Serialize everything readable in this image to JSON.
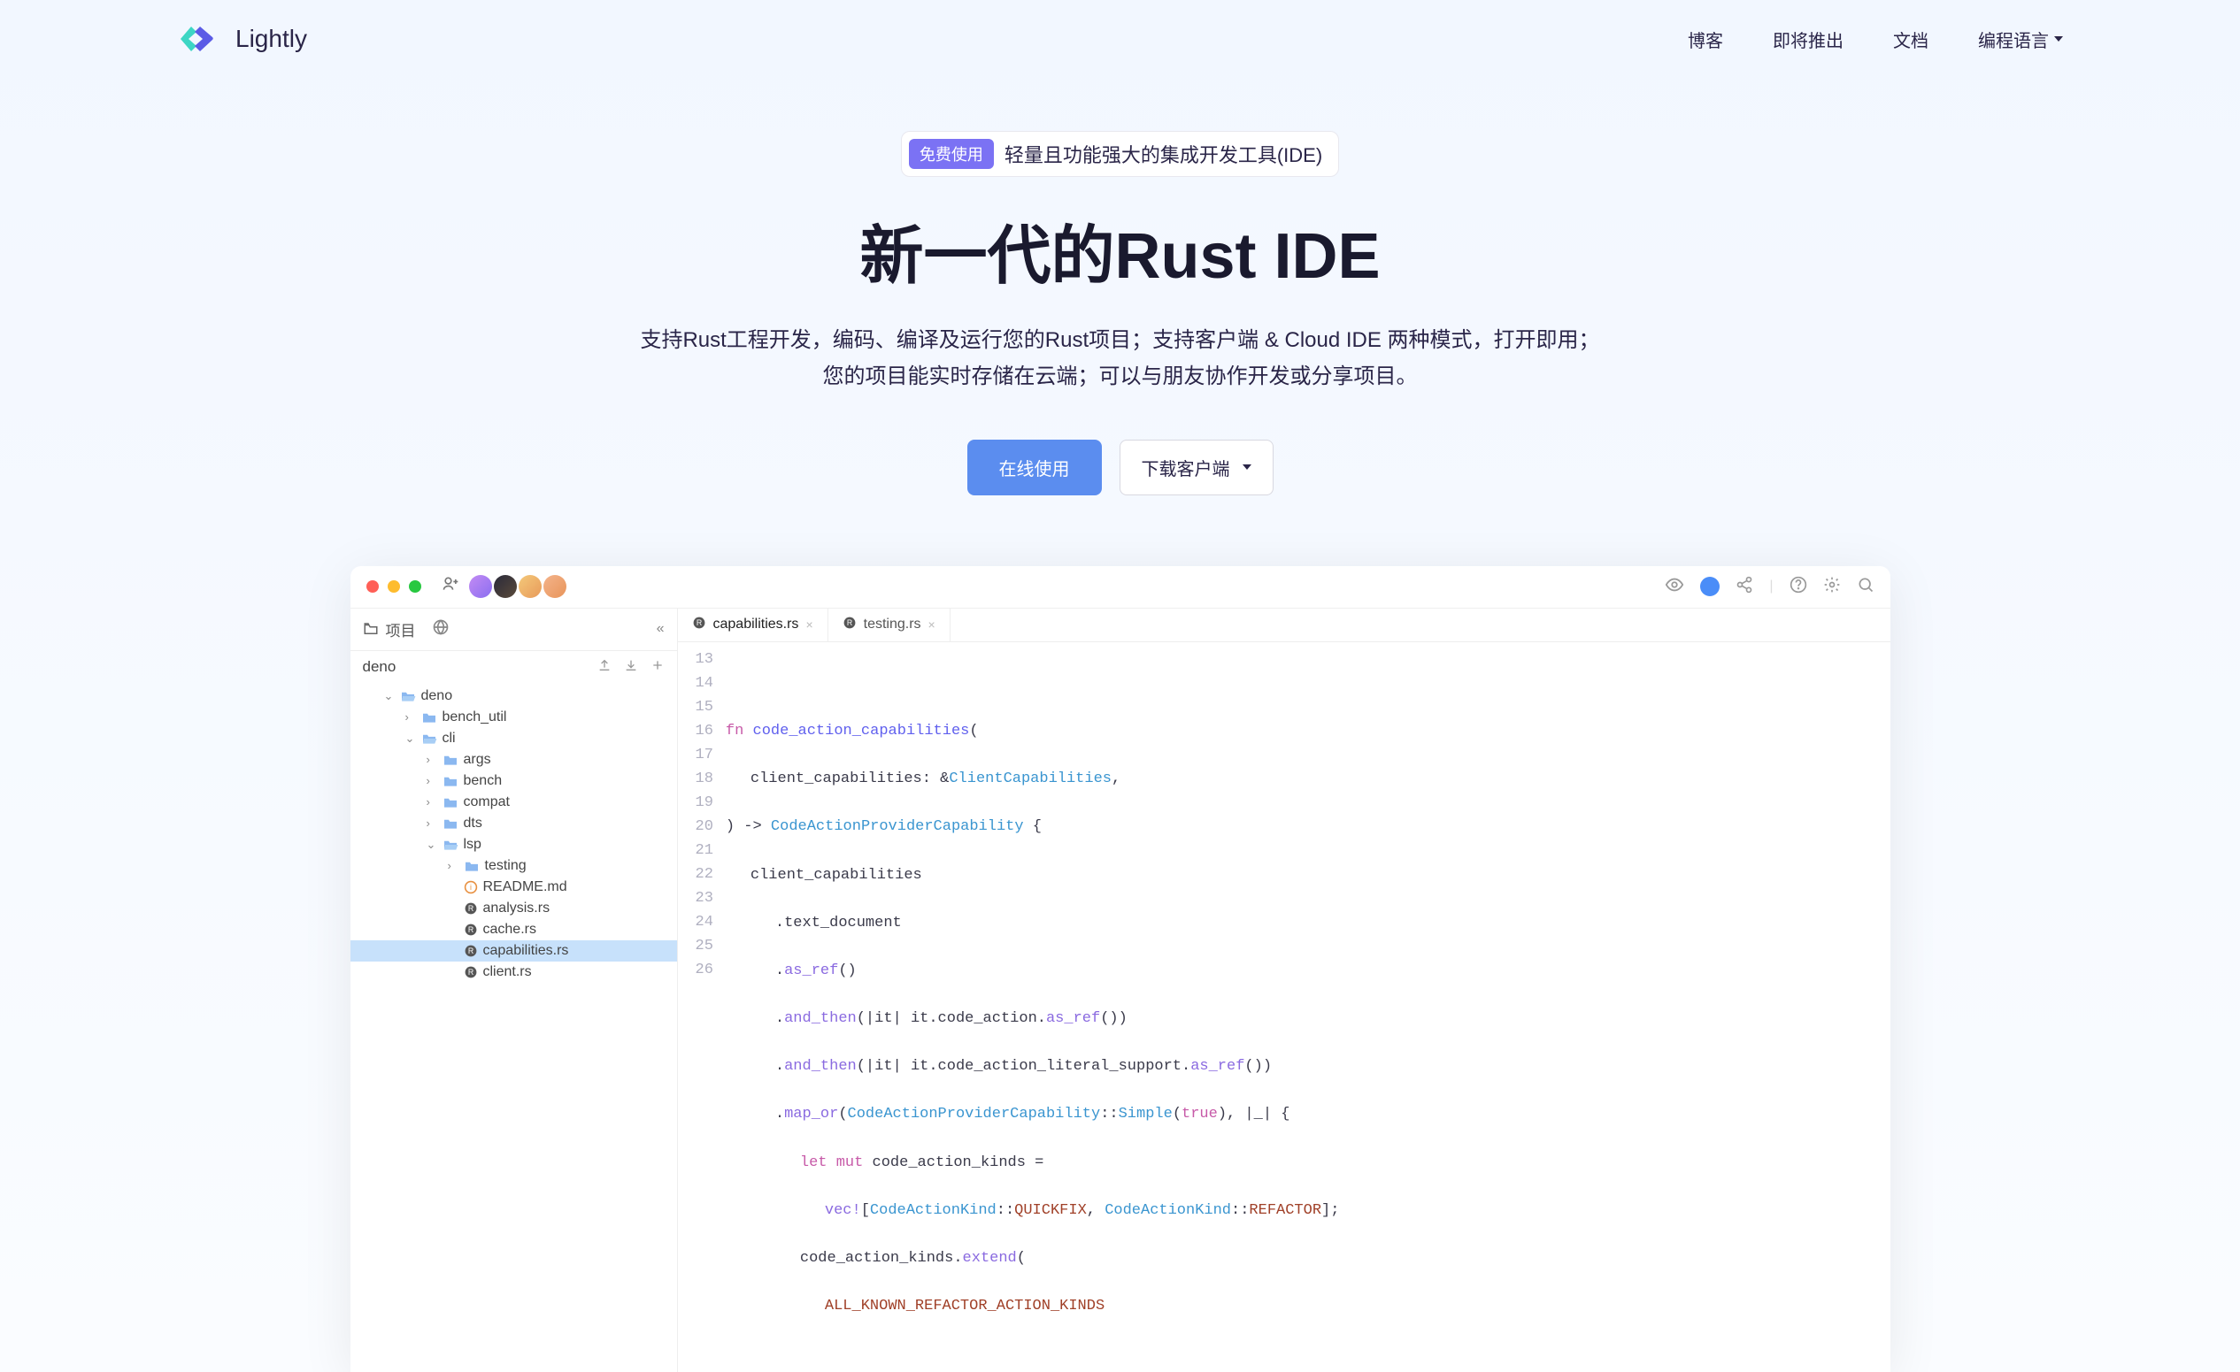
{
  "brand": "Lightly",
  "nav": {
    "blog": "博客",
    "coming": "即将推出",
    "docs": "文档",
    "lang": "编程语言"
  },
  "hero": {
    "badge": "免费使用",
    "badge_text": "轻量且功能强大的集成开发工具(IDE)",
    "title": "新一代的Rust IDE",
    "desc1": "支持Rust工程开发，编码、编译及运行您的Rust项目；支持客户端 & Cloud IDE 两种模式，打开即用；",
    "desc2": "您的项目能实时存储在云端；可以与朋友协作开发或分享项目。",
    "btn_online": "在线使用",
    "btn_download": "下载客户端"
  },
  "ide": {
    "sidebar_tab": "项目",
    "project": "deno",
    "tree": {
      "root": "deno",
      "items": [
        {
          "name": "bench_util",
          "type": "folder",
          "depth": 2
        },
        {
          "name": "cli",
          "type": "folder-open",
          "depth": 2
        },
        {
          "name": "args",
          "type": "folder",
          "depth": 3
        },
        {
          "name": "bench",
          "type": "folder",
          "depth": 3
        },
        {
          "name": "compat",
          "type": "folder",
          "depth": 3
        },
        {
          "name": "dts",
          "type": "folder",
          "depth": 3
        },
        {
          "name": "lsp",
          "type": "folder-open",
          "depth": 3
        },
        {
          "name": "testing",
          "type": "folder",
          "depth": 4
        },
        {
          "name": "README.md",
          "type": "md",
          "depth": 4
        },
        {
          "name": "analysis.rs",
          "type": "rust",
          "depth": 4
        },
        {
          "name": "cache.rs",
          "type": "rust",
          "depth": 4
        },
        {
          "name": "capabilities.rs",
          "type": "rust",
          "depth": 4,
          "selected": true
        },
        {
          "name": "client.rs",
          "type": "rust",
          "depth": 4
        }
      ]
    },
    "tabs": [
      {
        "name": "capabilities.rs",
        "active": true
      },
      {
        "name": "testing.rs",
        "active": false
      }
    ],
    "code_lines": [
      13,
      14,
      15,
      16,
      17,
      18,
      19,
      20,
      21,
      22,
      23,
      24,
      25,
      26
    ],
    "code": {
      "l14_fn": "fn",
      "l14_name": "code_action_capabilities",
      "l15_param": "client_capabilities",
      "l15_ty": "ClientCapabilities",
      "l16_ret": "CodeActionProviderCapability",
      "l17_ident": "client_capabilities",
      "l18_m": ".text_document",
      "l19_m": "as_ref",
      "l20_m1": "and_then",
      "l20_m2": "as_ref",
      "l21_m1": "and_then",
      "l21_m2": "as_ref",
      "l22_m1": "map_or",
      "l22_ty": "CodeActionProviderCapability",
      "l22_m2": "Simple",
      "l22_v": "true",
      "l23_let": "let",
      "l23_mut": "mut",
      "l23_v": "code_action_kinds",
      "l24_mac": "vec!",
      "l24_ty": "CodeActionKind",
      "l24_c1": "QUICKFIX",
      "l24_c2": "REFACTOR",
      "l25_v": "code_action_kinds",
      "l25_m": "extend",
      "l26_c": "ALL_KNOWN_REFACTOR_ACTION_KINDS"
    }
  }
}
